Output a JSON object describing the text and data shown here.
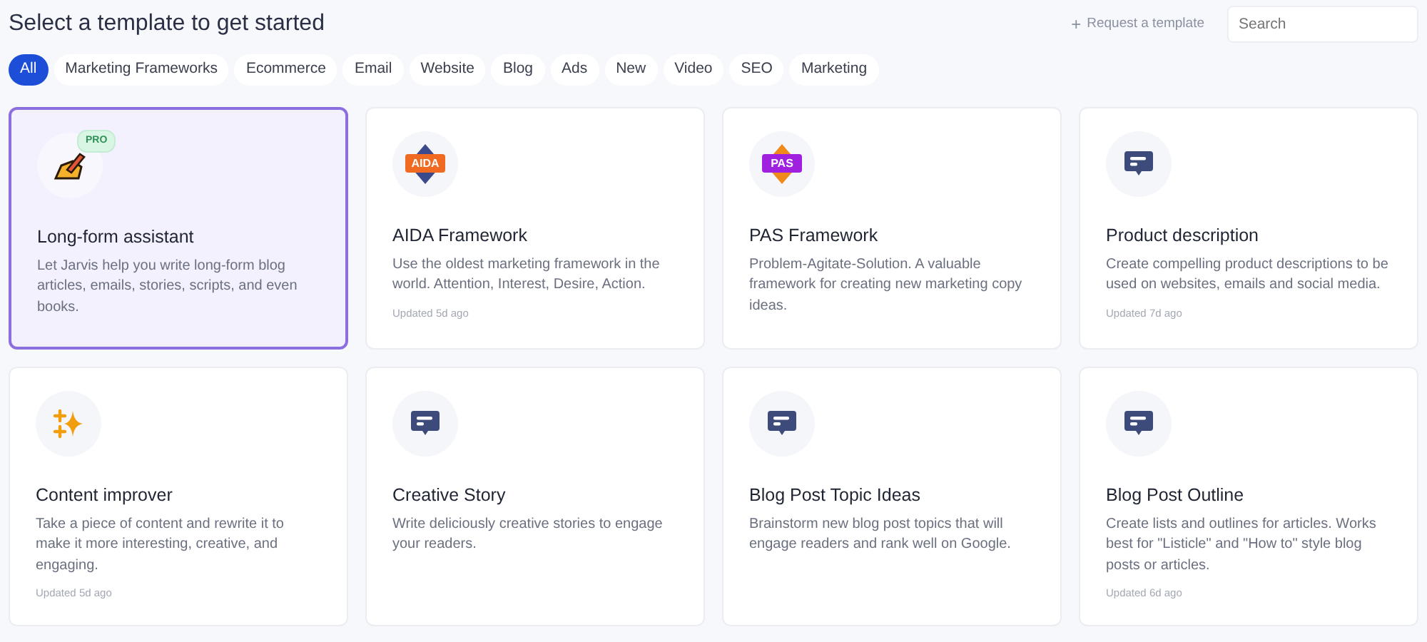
{
  "header": {
    "title": "Select a template to get started",
    "request_button": {
      "icon": "+",
      "label": "Request a template"
    },
    "search": {
      "placeholder": "Search"
    }
  },
  "filters": [
    {
      "label": "All",
      "selected": true
    },
    {
      "label": "Marketing Frameworks",
      "selected": false
    },
    {
      "label": "Ecommerce",
      "selected": false
    },
    {
      "label": "Email",
      "selected": false
    },
    {
      "label": "Website",
      "selected": false
    },
    {
      "label": "Blog",
      "selected": false
    },
    {
      "label": "Ads",
      "selected": false
    },
    {
      "label": "New",
      "selected": false
    },
    {
      "label": "Video",
      "selected": false
    },
    {
      "label": "SEO",
      "selected": false
    },
    {
      "label": "Marketing",
      "selected": false
    }
  ],
  "templates": [
    {
      "kind": "pencil",
      "badge": "PRO",
      "title": "Long-form assistant",
      "description": "Let Jarvis help you write long-form blog articles, emails, stories, scripts, and even books.",
      "selected": true
    },
    {
      "kind": "aida",
      "icon_text": "AIDA",
      "title": "AIDA Framework",
      "description": "Use the oldest marketing framework in the world. Attention, Interest, Desire, Action.",
      "updated": "Updated 5d ago",
      "selected": false
    },
    {
      "kind": "pas",
      "icon_text": "PAS",
      "title": "PAS Framework",
      "description": "Problem-Agitate-Solution. A valuable framework for creating new marketing copy ideas.",
      "selected": false
    },
    {
      "kind": "chat",
      "title": "Product description",
      "description": "Create compelling product descriptions to be used on websites, emails and social media.",
      "updated": "Updated 7d ago",
      "selected": false
    },
    {
      "kind": "sparkle",
      "title": "Content improver",
      "description": "Take a piece of content and rewrite it to make it more interesting, creative, and engaging.",
      "updated": "Updated 5d ago",
      "selected": false
    },
    {
      "kind": "chat",
      "title": "Creative Story",
      "description": "Write deliciously creative stories to engage your readers.",
      "selected": false
    },
    {
      "kind": "chat",
      "title": "Blog Post Topic Ideas",
      "description": "Brainstorm new blog post topics that will engage readers and rank well on Google.",
      "selected": false
    },
    {
      "kind": "chat",
      "title": "Blog Post Outline",
      "description": "Create lists and outlines for articles. Works best for \"Listicle\" and \"How to\" style blog posts or articles.",
      "updated": "Updated 6d ago",
      "selected": false
    }
  ]
}
